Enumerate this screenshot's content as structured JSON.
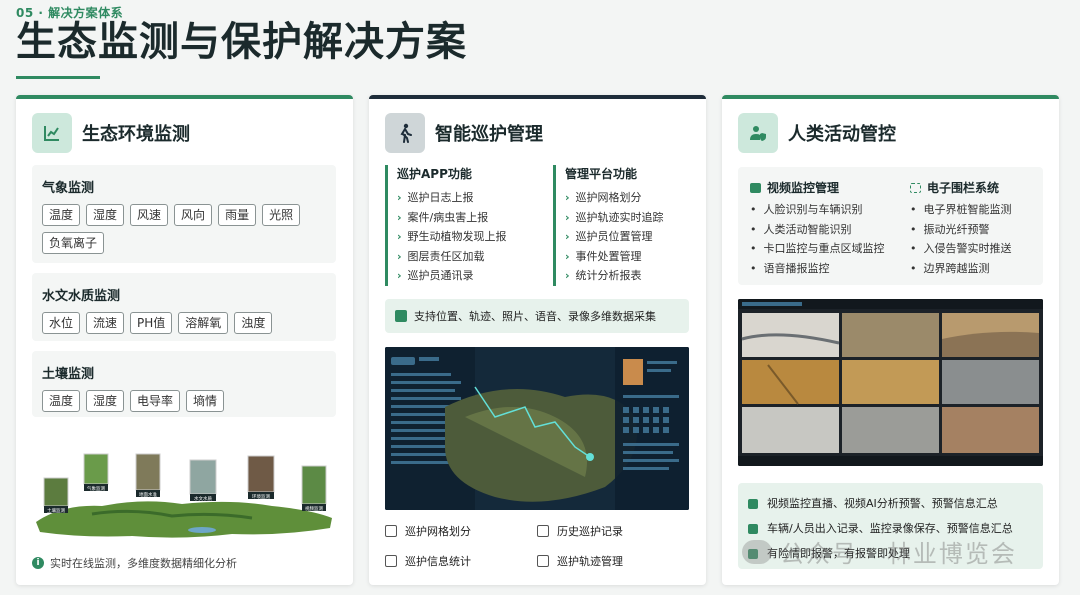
{
  "header": {
    "tag": "05 · 解决方案体系",
    "title": "生态监测与保护解决方案"
  },
  "colors": {
    "accent": "#2f8a61",
    "dark": "#1e2d3a",
    "panel": "#f4f6f5",
    "mint": "#e7f2ec"
  },
  "cards": [
    {
      "title": "生态环境监测",
      "icon": "chart-line-icon",
      "groups": [
        {
          "title": "气象监测",
          "tags": [
            "温度",
            "湿度",
            "风速",
            "风向",
            "雨量",
            "光照",
            "负氧离子"
          ]
        },
        {
          "title": "水文水质监测",
          "tags": [
            "水位",
            "流速",
            "PH值",
            "溶解氧",
            "浊度"
          ]
        },
        {
          "title": "土壤监测",
          "tags": [
            "温度",
            "湿度",
            "电导率",
            "墒情"
          ]
        }
      ],
      "landscape_labels": [
        "土壤监测",
        "气象监测",
        "地面水准",
        "水文水质",
        "环境监测",
        "视频监测"
      ],
      "note": "实时在线监测，多维度数据精细化分析"
    },
    {
      "title": "智能巡护管理",
      "icon": "walking-person-icon",
      "left": {
        "title": "巡护APP功能",
        "items": [
          "巡护日志上报",
          "案件/病虫害上报",
          "野生动植物发现上报",
          "图层责任区加载",
          "巡护员通讯录"
        ]
      },
      "right": {
        "title": "管理平台功能",
        "items": [
          "巡护网格划分",
          "巡护轨迹实时追踪",
          "巡护员位置管理",
          "事件处置管理",
          "统计分析报表"
        ]
      },
      "multi": "支持位置、轨迹、照片、语音、录像多维数据采集",
      "tools": [
        "巡护网格划分",
        "历史巡护记录",
        "巡护信息统计",
        "巡护轨迹管理"
      ]
    },
    {
      "title": "人类活动管控",
      "icon": "shield-person-icon",
      "video": {
        "title": "视频监控管理",
        "items": [
          "人脸识别与车辆识别",
          "人类活动智能识别",
          "卡口监控与重点区域监控",
          "语音播报监控"
        ]
      },
      "fence": {
        "title": "电子围栏系统",
        "items": [
          "电子界桩智能监测",
          "振动光纤预警",
          "入侵告警实时推送",
          "边界跨越监测"
        ]
      },
      "alerts": [
        "视频监控直播、视频AI分析预警、预警信息汇总",
        "车辆/人员出入记录、监控录像保存、预警信息汇总",
        "有险情即报警，有报警即处理"
      ]
    }
  ],
  "watermark": "公众号 · 林业博览会"
}
